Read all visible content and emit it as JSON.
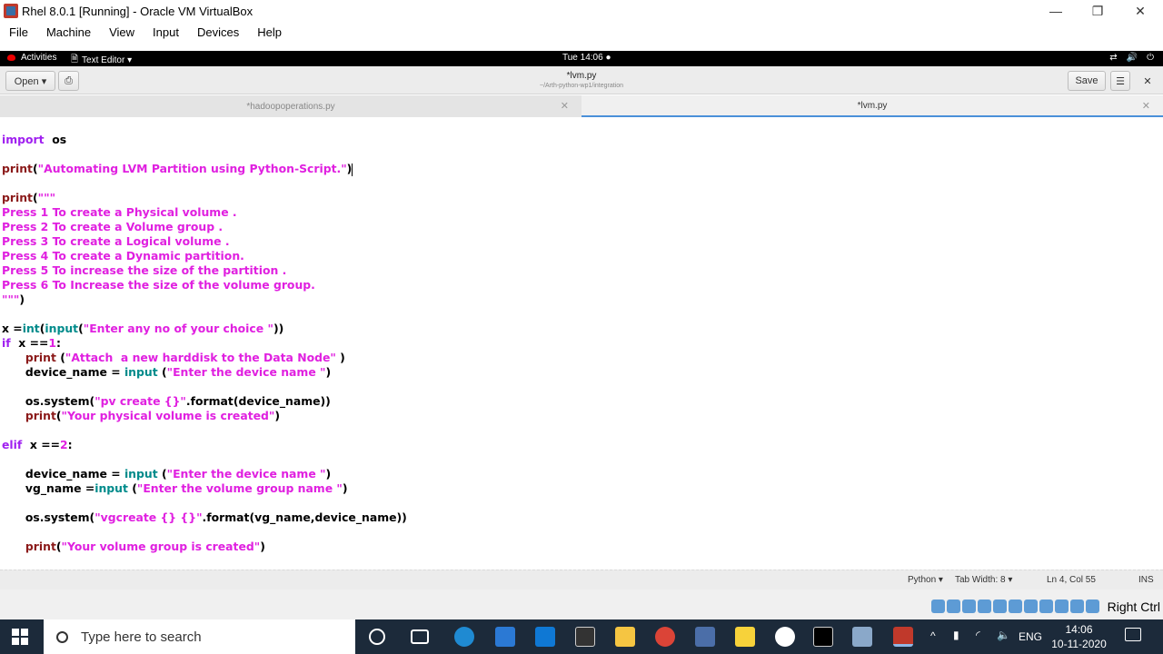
{
  "window": {
    "title": "Rhel 8.0.1 [Running] - Oracle VM VirtualBox",
    "minimize": "—",
    "restore": "❐",
    "close": "✕"
  },
  "vbox_menu": [
    "File",
    "Machine",
    "View",
    "Input",
    "Devices",
    "Help"
  ],
  "gnome_bar": {
    "activities": "Activities",
    "app_menu": "Text Editor ▾",
    "clock": "Tue 14:06 ●"
  },
  "header": {
    "open_label": "Open ▾",
    "doc_title": "*lvm.py",
    "doc_path": "~/Arth-python-wp1/integration",
    "save_label": "Save",
    "menu_icon": "☰",
    "close_icon": "✕"
  },
  "tabs": [
    {
      "label": "*hadoopoperations.py",
      "active": false
    },
    {
      "label": "*lvm.py",
      "active": true
    }
  ],
  "code": [
    [
      [
        "kw",
        "import"
      ],
      [
        "",
        "  os"
      ]
    ],
    [],
    [
      [
        "fn",
        "print"
      ],
      [
        "",
        "("
      ],
      [
        "st",
        "\"Automating LVM Partition using Python-Script.\""
      ],
      [
        "",
        ")"
      ],
      [
        "caret",
        ""
      ]
    ],
    [],
    [
      [
        "fn",
        "print"
      ],
      [
        "",
        "("
      ],
      [
        "st",
        "\"\"\""
      ]
    ],
    [
      [
        "st",
        "Press 1 To create a Physical volume ."
      ]
    ],
    [
      [
        "st",
        "Press 2 To create a Volume group ."
      ]
    ],
    [
      [
        "st",
        "Press 3 To create a Logical volume ."
      ]
    ],
    [
      [
        "st",
        "Press 4 To create a Dynamic partition."
      ]
    ],
    [
      [
        "st",
        "Press 5 To increase the size of the partition ."
      ]
    ],
    [
      [
        "st",
        "Press 6 To Increase the size of the volume group."
      ]
    ],
    [
      [
        "st",
        "\"\"\""
      ],
      [
        "",
        ")"
      ]
    ],
    [],
    [
      [
        "",
        "x ="
      ],
      [
        "bi",
        "int"
      ],
      [
        "",
        "("
      ],
      [
        "bi",
        "input"
      ],
      [
        "",
        "("
      ],
      [
        "st",
        "\"Enter any no of your choice \""
      ],
      [
        "",
        "))"
      ]
    ],
    [
      [
        "kw",
        "if"
      ],
      [
        "",
        "  x =="
      ],
      [
        "nm",
        "1"
      ],
      [
        "",
        ":"
      ]
    ],
    [
      [
        "",
        "      "
      ],
      [
        "fn",
        "print"
      ],
      [
        "",
        " ("
      ],
      [
        "st",
        "\"Attach  a new harddisk to the Data Node\""
      ],
      [
        "",
        " )"
      ]
    ],
    [
      [
        "",
        "      device_name = "
      ],
      [
        "bi",
        "input"
      ],
      [
        "",
        " ("
      ],
      [
        "st",
        "\"Enter the device name \""
      ],
      [
        "",
        ")"
      ]
    ],
    [],
    [
      [
        "",
        "      os.system("
      ],
      [
        "st",
        "\"pv create {}\""
      ],
      [
        "",
        ".format(device_name))"
      ]
    ],
    [
      [
        "",
        "      "
      ],
      [
        "fn",
        "print"
      ],
      [
        "",
        "("
      ],
      [
        "st",
        "\"Your physical volume is created\""
      ],
      [
        "",
        ")"
      ]
    ],
    [],
    [
      [
        "kw",
        "elif"
      ],
      [
        "",
        "  x =="
      ],
      [
        "nm",
        "2"
      ],
      [
        "",
        ":"
      ]
    ],
    [],
    [
      [
        "",
        "      device_name = "
      ],
      [
        "bi",
        "input"
      ],
      [
        "",
        " ("
      ],
      [
        "st",
        "\"Enter the device name \""
      ],
      [
        "",
        ")"
      ]
    ],
    [
      [
        "",
        "      vg_name ="
      ],
      [
        "bi",
        "input"
      ],
      [
        "",
        " ("
      ],
      [
        "st",
        "\"Enter the volume group name \""
      ],
      [
        "",
        ")"
      ]
    ],
    [],
    [
      [
        "",
        "      os.system("
      ],
      [
        "st",
        "\"vgcreate {} {}\""
      ],
      [
        "",
        ".format(vg_name,device_name))"
      ]
    ],
    [],
    [
      [
        "",
        "      "
      ],
      [
        "fn",
        "print"
      ],
      [
        "",
        "("
      ],
      [
        "st",
        "\"Your volume group is created\""
      ],
      [
        "",
        ")"
      ]
    ]
  ],
  "statusbar": {
    "language": "Python ▾",
    "tab_width": "Tab Width: 8 ▾",
    "position": "Ln 4, Col 55",
    "mode": "INS"
  },
  "vbox_status": {
    "host_key": "Right Ctrl"
  },
  "taskbar": {
    "search_placeholder": "Type here to search",
    "lang": "ENG",
    "time": "14:06",
    "date": "10-11-2020"
  }
}
